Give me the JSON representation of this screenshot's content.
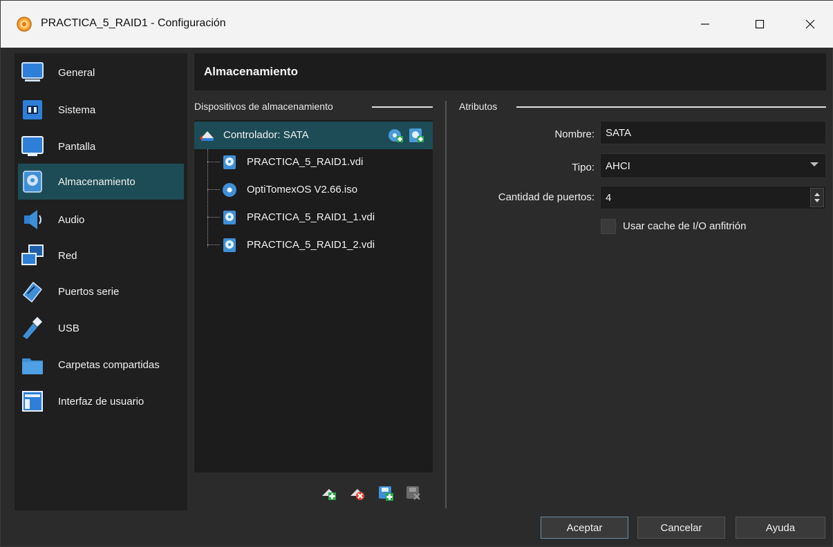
{
  "window": {
    "title": "PRACTICA_5_RAID1 - Configuración",
    "controls": {
      "minimize": "—",
      "maximize": "☐",
      "close": "✕"
    }
  },
  "sidebar": {
    "items": [
      {
        "label": "General",
        "icon": "monitor-icon"
      },
      {
        "label": "Sistema",
        "icon": "chip-icon"
      },
      {
        "label": "Pantalla",
        "icon": "display-icon"
      },
      {
        "label": "Almacenamiento",
        "icon": "storage-disk-icon",
        "active": true
      },
      {
        "label": "Audio",
        "icon": "speaker-icon"
      },
      {
        "label": "Red",
        "icon": "network-icon"
      },
      {
        "label": "Puertos serie",
        "icon": "serial-port-icon"
      },
      {
        "label": "USB",
        "icon": "usb-icon"
      },
      {
        "label": "Carpetas compartidas",
        "icon": "shared-folder-icon"
      },
      {
        "label": "Interfaz de usuario",
        "icon": "user-interface-icon"
      }
    ]
  },
  "page": {
    "title": "Almacenamiento"
  },
  "storage": {
    "group_label": "Dispositivos de almacenamiento",
    "controller": {
      "label": "Controlador: SATA"
    },
    "devices": [
      {
        "label": "PRACTICA_5_RAID1.vdi",
        "icon": "hard-disk-icon"
      },
      {
        "label": "OptiTomexOS V2.66.iso",
        "icon": "optical-disc-icon"
      },
      {
        "label": "PRACTICA_5_RAID1_1.vdi",
        "icon": "hard-disk-icon"
      },
      {
        "label": "PRACTICA_5_RAID1_2.vdi",
        "icon": "hard-disk-icon"
      }
    ]
  },
  "attributes": {
    "group_label": "Atributos",
    "name_label": "Nombre:",
    "name_value": "SATA",
    "type_label": "Tipo:",
    "type_value": "AHCI",
    "ports_label": "Cantidad de puertos:",
    "ports_value": "4",
    "cache_label": "Usar cache de I/O anfitrión",
    "cache_checked": false
  },
  "buttons": {
    "ok": "Aceptar",
    "cancel": "Cancelar",
    "help": "Ayuda"
  },
  "colors": {
    "accent": "#1d4c56",
    "background": "#2b2b2b",
    "panel": "#1c1c1c"
  }
}
